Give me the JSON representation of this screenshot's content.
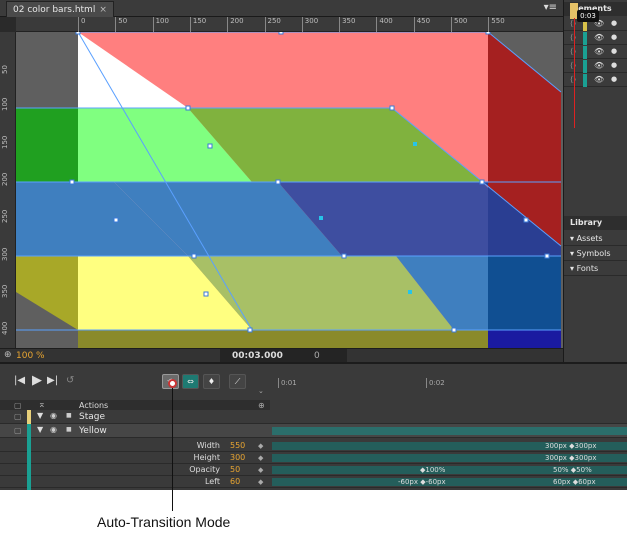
{
  "document_tab": {
    "title": "02 color bars.html",
    "close": "×"
  },
  "tab_menu_icon": "▾≡",
  "ruler_top": [
    "0",
    "50",
    "100",
    "150",
    "200",
    "250",
    "300",
    "350",
    "400",
    "450",
    "500",
    "550"
  ],
  "ruler_left": [
    "50",
    "100",
    "150",
    "200",
    "250",
    "300",
    "350",
    "400"
  ],
  "stage_status": {
    "zoom": "100 %",
    "time": "00:03.000",
    "frame": "0"
  },
  "elements_panel": {
    "title": "Elements",
    "rows": [
      {
        "color": "#d8c24a"
      },
      {
        "color": "#1aa093"
      },
      {
        "color": "#1aa093"
      },
      {
        "color": "#1aa093"
      },
      {
        "color": "#1aa093"
      }
    ]
  },
  "library_panel": {
    "title": "Library",
    "items": [
      "Assets",
      "Symbols",
      "Fonts"
    ]
  },
  "timeline": {
    "ticks": [
      "0:01",
      "0:02",
      "0:03"
    ],
    "playhead_label": "0:03",
    "actions_label": "Actions",
    "layers": [
      {
        "name": "Stage",
        "color": "#e8d07a"
      },
      {
        "name": "Yellow",
        "color": "#1aa093"
      }
    ],
    "properties": [
      {
        "label": "Width",
        "value": "550",
        "annotations": [
          {
            "text": "300px ◆300px"
          }
        ]
      },
      {
        "label": "Height",
        "value": "300",
        "annotations": [
          {
            "text": "300px ◆300px"
          }
        ]
      },
      {
        "label": "Opacity",
        "value": "50",
        "annotations": [
          {
            "text": "◆100%"
          },
          {
            "text": "50% ◆50%"
          }
        ]
      },
      {
        "label": "Left",
        "value": "60",
        "annotations": [
          {
            "text": "-60px ◆-60px"
          },
          {
            "text": "60px ◆60px"
          }
        ]
      }
    ]
  },
  "callout": {
    "label": "Auto-Transition Mode"
  },
  "colors": {
    "red": "#ff7f7f",
    "green": "#80ff80",
    "blue": "#4a7fc0",
    "yellow": "#ffff80",
    "accent": "#e8a531",
    "playhead": "#dd2222"
  }
}
